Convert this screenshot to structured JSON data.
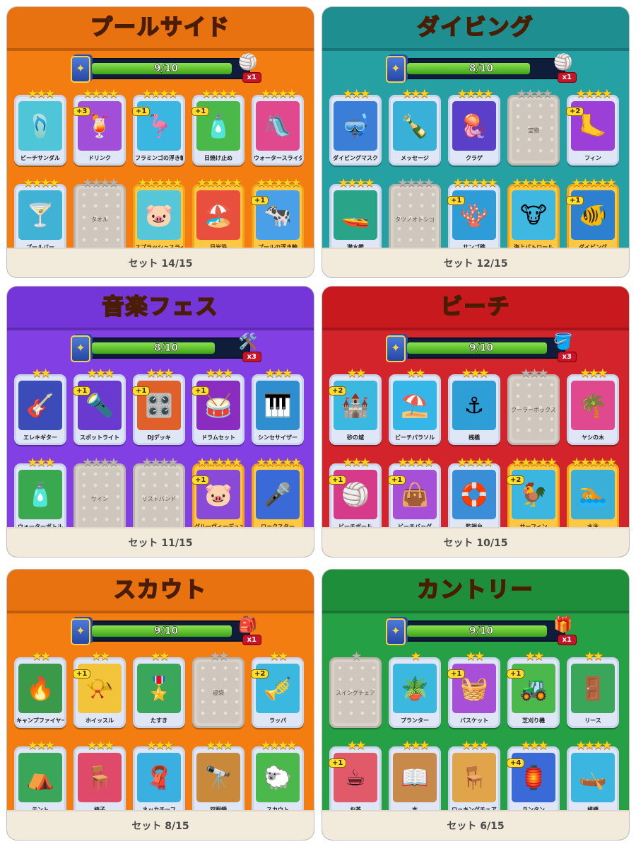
{
  "panels": [
    {
      "title": "プールサイド",
      "header_color": "#e8720f",
      "body_color": "#f37d11",
      "progress_text": "9/10",
      "progress_fraction": 0.9,
      "reward_icon": "beach-ball-icon",
      "reward_multiplier": "x1",
      "set_text": "セット 14/15",
      "cards": [
        {
          "name": "ビーチサンダル",
          "stars": 3,
          "max_stars": 3,
          "state": "got",
          "icon": "sandals-icon",
          "glyph": "🩴",
          "art": "#4fc6d8"
        },
        {
          "name": "ドリンク",
          "stars": 3,
          "max_stars": 4,
          "state": "got",
          "dup": "+3",
          "icon": "drink-icon",
          "glyph": "🍹",
          "art": "#a14fd8"
        },
        {
          "name": "フラミンゴの浮き輪",
          "stars": 3,
          "max_stars": 4,
          "state": "got",
          "dup": "+1",
          "icon": "flamingo-float-icon",
          "glyph": "🦩",
          "art": "#39b7e0"
        },
        {
          "name": "日焼け止め",
          "stars": 4,
          "max_stars": 4,
          "state": "got",
          "dup": "+1",
          "icon": "sunscreen-icon",
          "glyph": "🧴",
          "art": "#4bb84a"
        },
        {
          "name": "ウォータースライダー",
          "stars": 3,
          "max_stars": 4,
          "state": "got",
          "icon": "water-slide-icon",
          "glyph": "🛝",
          "art": "#e0498d"
        },
        {
          "name": "プールバー",
          "stars": 4,
          "max_stars": 4,
          "state": "got",
          "icon": "pool-bar-icon",
          "glyph": "🍸",
          "art": "#3fb2d6"
        },
        {
          "name": "タオル",
          "stars": 0,
          "max_stars": 4,
          "state": "miss",
          "icon": "towel-icon"
        },
        {
          "name": "スプラッシュスライド",
          "stars": 5,
          "max_stars": 5,
          "state": "gold",
          "icon": "splash-slide-icon",
          "glyph": "🐷",
          "art": "#55c7d8"
        },
        {
          "name": "日光浴",
          "stars": 5,
          "max_stars": 5,
          "state": "gold",
          "icon": "sunbathing-icon",
          "glyph": "🏖️",
          "art": "#e84f3c"
        },
        {
          "name": "プールの浮き輪",
          "stars": 5,
          "max_stars": 5,
          "state": "gold",
          "dup": "+1",
          "icon": "pool-float-icon",
          "glyph": "🐄",
          "art": "#4aa0e8"
        }
      ]
    },
    {
      "title": "ダイビング",
      "header_color": "#1f8e90",
      "body_color": "#25a1a3",
      "progress_text": "8/10",
      "progress_fraction": 0.8,
      "reward_icon": "beach-ball-icon",
      "reward_multiplier": "x1",
      "set_text": "セット 12/15",
      "cards": [
        {
          "name": "ダイビングマスク",
          "stars": 3,
          "max_stars": 3,
          "state": "got",
          "icon": "diving-mask-icon",
          "glyph": "🤿",
          "art": "#3a7ed8"
        },
        {
          "name": "メッセージ",
          "stars": 3,
          "max_stars": 3,
          "state": "got",
          "icon": "message-bottle-icon",
          "glyph": "🍾",
          "art": "#38b0d8"
        },
        {
          "name": "クラゲ",
          "stars": 3,
          "max_stars": 4,
          "state": "got",
          "icon": "jellyfish-icon",
          "glyph": "🪼",
          "art": "#5a3fc8"
        },
        {
          "name": "宝物",
          "stars": 0,
          "max_stars": 4,
          "state": "miss",
          "icon": "treasure-icon"
        },
        {
          "name": "フィン",
          "stars": 4,
          "max_stars": 4,
          "state": "got",
          "dup": "+2",
          "icon": "fins-icon",
          "glyph": "🦶",
          "art": "#9b3fd8"
        },
        {
          "name": "潜水艦",
          "stars": 4,
          "max_stars": 4,
          "state": "got",
          "icon": "submarine-icon",
          "glyph": "🚤",
          "art": "#2aa488"
        },
        {
          "name": "タツノオトシゴ",
          "stars": 0,
          "max_stars": 4,
          "state": "miss",
          "icon": "seahorse-icon"
        },
        {
          "name": "サンゴ礁",
          "stars": 5,
          "max_stars": 5,
          "state": "got",
          "dup": "+1",
          "icon": "coral-reef-icon",
          "glyph": "🪸",
          "art": "#2e9cd6"
        },
        {
          "name": "海上パトロール",
          "stars": 5,
          "max_stars": 5,
          "state": "gold",
          "icon": "sea-patrol-icon",
          "glyph": "🐮",
          "art": "#3eb8e0"
        },
        {
          "name": "ダイビング",
          "stars": 5,
          "max_stars": 5,
          "state": "gold",
          "dup": "+1",
          "icon": "diver-icon",
          "glyph": "🐠",
          "art": "#2d7fd0"
        }
      ]
    },
    {
      "title": "音楽フェス",
      "header_color": "#7436d8",
      "body_color": "#8240e4",
      "progress_text": "8/10",
      "progress_fraction": 0.8,
      "reward_icon": "tools-icon",
      "reward_multiplier": "x3",
      "set_text": "セット 11/15",
      "cards": [
        {
          "name": "エレキギター",
          "stars": 2,
          "max_stars": 2,
          "state": "got",
          "icon": "electric-guitar-icon",
          "glyph": "🎸",
          "art": "#3b4bb8"
        },
        {
          "name": "スポットライト",
          "stars": 2,
          "max_stars": 3,
          "state": "got",
          "dup": "+1",
          "icon": "spotlight-icon",
          "glyph": "🔦",
          "art": "#6a3ad0"
        },
        {
          "name": "DJデッキ",
          "stars": 3,
          "max_stars": 3,
          "state": "got",
          "dup": "+1",
          "icon": "dj-deck-icon",
          "glyph": "🎛️",
          "art": "#e0602a"
        },
        {
          "name": "ドラムセット",
          "stars": 3,
          "max_stars": 3,
          "state": "got",
          "dup": "+1",
          "icon": "drum-set-icon",
          "glyph": "🥁",
          "art": "#8a2cc0"
        },
        {
          "name": "シンセサイザー",
          "stars": 3,
          "max_stars": 3,
          "state": "got",
          "icon": "synthesizer-icon",
          "glyph": "🎹",
          "art": "#2f8ed0"
        },
        {
          "name": "ウォーターボトル",
          "stars": 3,
          "max_stars": 3,
          "state": "got",
          "icon": "water-bottle-icon",
          "glyph": "🧴",
          "art": "#3aa84e"
        },
        {
          "name": "サイン",
          "stars": 0,
          "max_stars": 4,
          "state": "miss",
          "icon": "autograph-icon"
        },
        {
          "name": "リストバンド",
          "stars": 0,
          "max_stars": 4,
          "state": "miss",
          "icon": "wristband-icon"
        },
        {
          "name": "グルーヴィーデュオ",
          "stars": 5,
          "max_stars": 5,
          "state": "gold",
          "dup": "+1",
          "icon": "groovy-duo-icon",
          "glyph": "🐷",
          "art": "#8a4ad8"
        },
        {
          "name": "ロックスター",
          "stars": 5,
          "max_stars": 5,
          "state": "gold",
          "icon": "rock-star-icon",
          "glyph": "🎤",
          "art": "#3a6ad8"
        }
      ]
    },
    {
      "title": "ビーチ",
      "header_color": "#c8191f",
      "body_color": "#d3242b",
      "progress_text": "9/10",
      "progress_fraction": 0.9,
      "reward_icon": "bucket-icon",
      "reward_multiplier": "x3",
      "set_text": "セット 10/15",
      "cards": [
        {
          "name": "砂の城",
          "stars": 2,
          "max_stars": 2,
          "state": "got",
          "dup": "+2",
          "icon": "sand-castle-icon",
          "glyph": "🏰",
          "art": "#3ab8e0"
        },
        {
          "name": "ビーチパラソル",
          "stars": 2,
          "max_stars": 2,
          "state": "got",
          "icon": "beach-umbrella-icon",
          "glyph": "⛱️",
          "art": "#35b6e8"
        },
        {
          "name": "桟橋",
          "stars": 2,
          "max_stars": 3,
          "state": "got",
          "icon": "pier-icon",
          "glyph": "⚓",
          "art": "#2e9ed6"
        },
        {
          "name": "クーラーボックス",
          "stars": 0,
          "max_stars": 3,
          "state": "miss",
          "icon": "cooler-box-icon"
        },
        {
          "name": "ヤシの木",
          "stars": 3,
          "max_stars": 3,
          "state": "got",
          "icon": "palm-tree-icon",
          "glyph": "🌴",
          "art": "#e0498d"
        },
        {
          "name": "ビーチボール",
          "stars": 3,
          "max_stars": 3,
          "state": "got",
          "dup": "+1",
          "icon": "beach-ball-icon",
          "glyph": "🏐",
          "art": "#d83a8a"
        },
        {
          "name": "ビーチバッグ",
          "stars": 4,
          "max_stars": 4,
          "state": "got",
          "dup": "+1",
          "icon": "beach-bag-icon",
          "glyph": "👜",
          "art": "#a84fd8"
        },
        {
          "name": "監視台",
          "stars": 4,
          "max_stars": 4,
          "state": "got",
          "icon": "lifeguard-tower-icon",
          "glyph": "🛟",
          "art": "#3a8ed8"
        },
        {
          "name": "サーフィン",
          "stars": 5,
          "max_stars": 5,
          "state": "gold",
          "dup": "+2",
          "icon": "surfing-icon",
          "glyph": "🐓",
          "art": "#3ab6e0"
        },
        {
          "name": "水泳",
          "stars": 5,
          "max_stars": 5,
          "state": "gold",
          "icon": "swimming-icon",
          "glyph": "🏊",
          "art": "#3ab0d8"
        }
      ]
    },
    {
      "title": "スカウト",
      "header_color": "#e8720f",
      "body_color": "#f37d11",
      "progress_text": "9/10",
      "progress_fraction": 0.9,
      "reward_icon": "backpack-icon",
      "reward_multiplier": "x1",
      "set_text": "セット 8/15",
      "cards": [
        {
          "name": "キャンプファイヤー",
          "stars": 2,
          "max_stars": 2,
          "state": "got",
          "icon": "campfire-icon",
          "glyph": "🔥",
          "art": "#3a9a4a"
        },
        {
          "name": "ホイッスル",
          "stars": 2,
          "max_stars": 2,
          "state": "got",
          "dup": "+1",
          "icon": "whistle-icon",
          "glyph": "📯",
          "art": "#f2c43a"
        },
        {
          "name": "たすき",
          "stars": 2,
          "max_stars": 2,
          "state": "got",
          "icon": "sash-icon",
          "glyph": "🎖️",
          "art": "#3aa65a"
        },
        {
          "name": "寝袋",
          "stars": 0,
          "max_stars": 2,
          "state": "miss",
          "icon": "sleeping-bag-icon"
        },
        {
          "name": "ラッパ",
          "stars": 2,
          "max_stars": 2,
          "state": "got",
          "dup": "+2",
          "icon": "bugle-icon",
          "glyph": "🎺",
          "art": "#3ab8e0"
        },
        {
          "name": "テント",
          "stars": 3,
          "max_stars": 3,
          "state": "got",
          "icon": "tent-icon",
          "glyph": "⛺",
          "art": "#3aa65a"
        },
        {
          "name": "椅子",
          "stars": 3,
          "max_stars": 3,
          "state": "got",
          "icon": "chair-icon",
          "glyph": "🪑",
          "art": "#e04a6a"
        },
        {
          "name": "ネッカチーフ",
          "stars": 3,
          "max_stars": 3,
          "state": "got",
          "icon": "neckerchief-icon",
          "glyph": "🧣",
          "art": "#3ab0e0"
        },
        {
          "name": "双眼鏡",
          "stars": 3,
          "max_stars": 3,
          "state": "got",
          "icon": "binoculars-icon",
          "glyph": "🔭",
          "art": "#c88a3a"
        },
        {
          "name": "スカウト",
          "stars": 4,
          "max_stars": 4,
          "state": "got",
          "icon": "scout-icon",
          "glyph": "🐑",
          "art": "#4ab84a"
        }
      ]
    },
    {
      "title": "カントリー",
      "header_color": "#1f8e3a",
      "body_color": "#25a045",
      "progress_text": "9/10",
      "progress_fraction": 0.9,
      "reward_icon": "gift-icon",
      "reward_multiplier": "x1",
      "set_text": "セット 6/15",
      "cards": [
        {
          "name": "スイングチェア",
          "stars": 1,
          "max_stars": 1,
          "state": "miss",
          "icon": "swing-chair-icon"
        },
        {
          "name": "プランター",
          "stars": 1,
          "max_stars": 1,
          "state": "got",
          "icon": "planter-icon",
          "glyph": "🪴",
          "art": "#3ab8e0"
        },
        {
          "name": "バスケット",
          "stars": 2,
          "max_stars": 2,
          "state": "got",
          "dup": "+1",
          "icon": "basket-icon",
          "glyph": "🧺",
          "art": "#a84fd8"
        },
        {
          "name": "芝刈り機",
          "stars": 2,
          "max_stars": 2,
          "state": "got",
          "dup": "+1",
          "icon": "lawn-mower-icon",
          "glyph": "🚜",
          "art": "#4ab84a"
        },
        {
          "name": "リース",
          "stars": 2,
          "max_stars": 2,
          "state": "got",
          "icon": "wreath-icon",
          "glyph": "🚪",
          "art": "#3aa65a"
        },
        {
          "name": "お茶",
          "stars": 2,
          "max_stars": 2,
          "state": "got",
          "dup": "+1",
          "icon": "tea-icon",
          "glyph": "☕",
          "art": "#e05a6a"
        },
        {
          "name": "本",
          "stars": 3,
          "max_stars": 3,
          "state": "got",
          "icon": "book-icon",
          "glyph": "📖",
          "art": "#c88a4a"
        },
        {
          "name": "ロッキングチェア",
          "stars": 3,
          "max_stars": 3,
          "state": "got",
          "icon": "rocking-chair-icon",
          "glyph": "🪑",
          "art": "#e0a44a"
        },
        {
          "name": "ランタン",
          "stars": 3,
          "max_stars": 3,
          "state": "got",
          "dup": "+4",
          "icon": "lantern-icon",
          "glyph": "🏮",
          "art": "#3a6ad8"
        },
        {
          "name": "桟橋",
          "stars": 4,
          "max_stars": 4,
          "state": "got",
          "icon": "rowboat-icon",
          "glyph": "🛶",
          "art": "#3ab6e0"
        }
      ]
    }
  ]
}
